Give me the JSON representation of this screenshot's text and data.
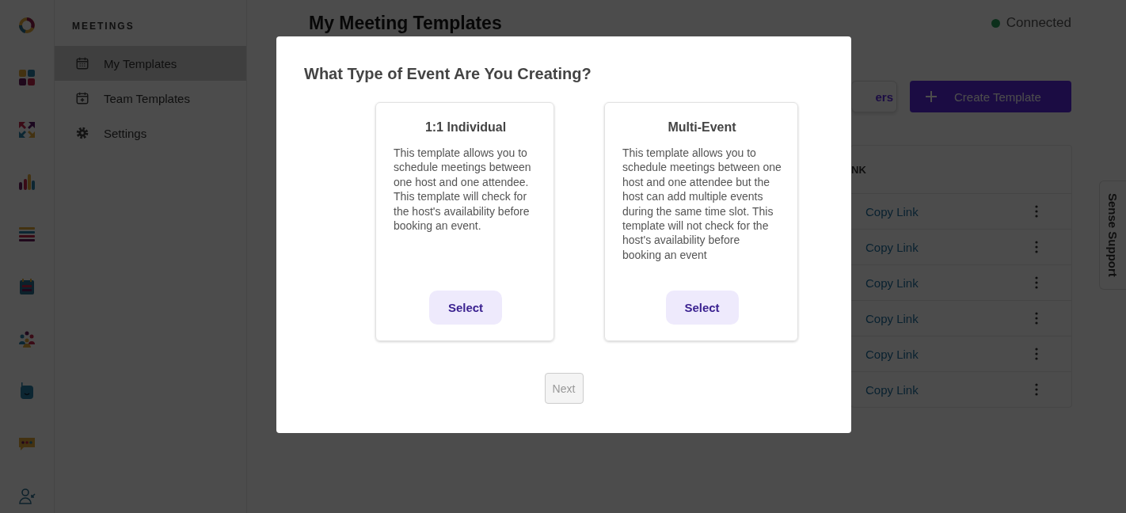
{
  "sidebar": {
    "heading": "MEETINGS",
    "items": [
      {
        "label": "My Templates",
        "kind": "calendar",
        "selected": true
      },
      {
        "label": "Team Templates",
        "kind": "calendar-plus",
        "selected": false
      },
      {
        "label": "Settings",
        "kind": "gear",
        "selected": false
      }
    ]
  },
  "page": {
    "title": "My Meeting Templates",
    "status": "Connected",
    "buttons": [
      {
        "label": "ers",
        "kind": "outline"
      },
      {
        "label": "Create Template",
        "kind": "primary"
      }
    ],
    "table": {
      "column_1": "NK",
      "rows": [
        {
          "link": "Copy Link"
        },
        {
          "link": "Copy Link"
        },
        {
          "link": "Copy Link"
        },
        {
          "link": "Copy Link"
        },
        {
          "link": "Copy Link"
        },
        {
          "link": "Copy Link"
        }
      ]
    }
  },
  "support_tab": "Sense Support",
  "modal": {
    "title": "What Type of Event Are You Creating?",
    "options": [
      {
        "title": "1:1 Individual",
        "description": "This template allows you to schedule meetings between one host and one attendee. This template will check for the host's availability before booking an event.",
        "button": "Select"
      },
      {
        "title": "Multi-Event",
        "description": "This template allows you to schedule meetings between one host and one attendee but the host can add multiple events during the same time slot. This template will not check for the host's availability before booking an event",
        "button": "Select"
      }
    ],
    "next_button": {
      "label": "Next",
      "disabled": true
    }
  }
}
